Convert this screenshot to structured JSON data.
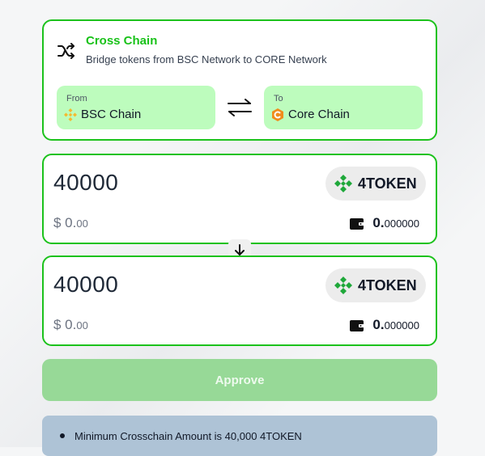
{
  "cross_chain": {
    "title": "Cross Chain",
    "subtitle": "Bridge tokens from BSC Network to CORE Network",
    "icon": "shuffle-icon",
    "from": {
      "label": "From",
      "chain": "BSC Chain",
      "icon": "bnb-logo-icon"
    },
    "to": {
      "label": "To",
      "chain": "Core Chain",
      "icon": "core-logo-icon"
    },
    "swap_icon": "swap-arrows-icon"
  },
  "send": {
    "amount": "40000",
    "token": "4TOKEN",
    "usd_main": "$ 0.",
    "usd_dec": "00",
    "balance_main": "0.",
    "balance_dec": "000000"
  },
  "receive": {
    "amount": "40000",
    "token": "4TOKEN",
    "usd_main": "$ 0.",
    "usd_dec": "00",
    "balance_main": "0.",
    "balance_dec": "000000"
  },
  "approve_label": "Approve",
  "info": {
    "minimum": "Minimum Crosschain Amount is 40,000 4TOKEN"
  },
  "colors": {
    "accent": "#1cc21c",
    "chain_box": "#bdfcbd",
    "approve": "#97d997",
    "info_bg": "#aec3d6"
  }
}
